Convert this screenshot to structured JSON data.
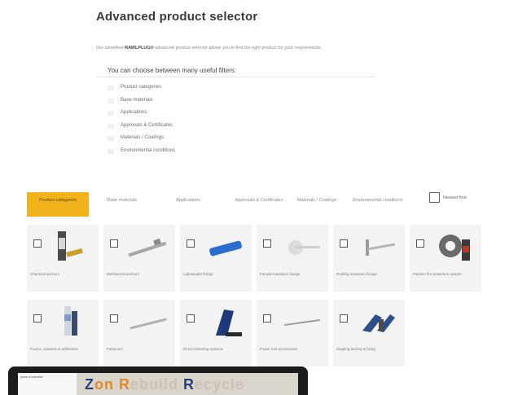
{
  "page": {
    "title": "Advanced product selector",
    "intro_prefix": "Our simplified",
    "intro_brand": "RAWLPLUG®",
    "intro_suffix": "advanced product selector allows you to find the right product for your requirements.",
    "filters_heading": "You can choose between many useful filters:",
    "filters": [
      "Product categories",
      "Base materials",
      "Applications",
      "Approvals & Certificates",
      "Materials / Coatings",
      "Environmental conditions"
    ]
  },
  "tabs": [
    {
      "label": "Product categories",
      "active": true
    },
    {
      "label": "Base materials",
      "active": false
    },
    {
      "label": "Applications",
      "active": false
    },
    {
      "label": "Approvals & Certificates",
      "active": false
    },
    {
      "label": "Materials / Coatings",
      "active": false
    },
    {
      "label": "Environmental conditions",
      "active": false
    }
  ],
  "newest_label": "Newest first",
  "categories": [
    {
      "label": "Chemical anchors",
      "icon": "cartridge-icon"
    },
    {
      "label": "Mechanical anchors",
      "icon": "anchor-bolt-icon"
    },
    {
      "label": "Lightweight fixings",
      "icon": "plug-icon"
    },
    {
      "label": "Facade insulation fixings",
      "icon": "insulation-fixing-icon"
    },
    {
      "label": "Roofing insulation fixings",
      "icon": "roofing-fixing-icon"
    },
    {
      "label": "Passive fire protection system",
      "icon": "fire-sealant-icon"
    },
    {
      "label": "Foams, sealants & adhesives",
      "icon": "foam-can-icon"
    },
    {
      "label": "Fasteners",
      "icon": "screw-icon"
    },
    {
      "label": "Direct fastening systems",
      "icon": "nail-gun-icon"
    },
    {
      "label": "Power tool accessories",
      "icon": "drill-bit-icon"
    },
    {
      "label": "Stapling tacking & fixing",
      "icon": "staple-gun-icon"
    }
  ],
  "laptop": {
    "left_text": "years of expertise",
    "big_text_a": "Z",
    "big_text_b": "on",
    "big_text_c": "R",
    "big_text_d": "ebuild",
    "big_text_e": " R",
    "big_text_f": "ecycle"
  },
  "colors": {
    "accent": "#f2b21a",
    "card_bg": "#f3f3f3"
  }
}
